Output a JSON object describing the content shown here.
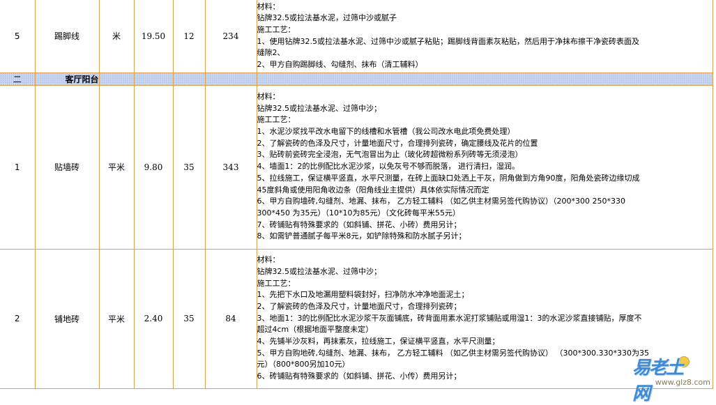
{
  "rows": [
    {
      "num": "5",
      "name": "踢脚线",
      "unit": "米",
      "price": "19.50",
      "qty": "12",
      "total": "234",
      "desc": [
        "材料：",
        "钻牌32.5或拉法基水泥，过筛中沙或腻子",
        "施工工艺：",
        "1、使用钻牌32.5或拉法基水泥、过筛中沙或腻子粘贴；踢脚线背面素灰粘贴，然后用于净抹布擦干净瓷砖表面及",
        "缝隙2、",
        "2、甲方自购踢脚线、勾缝剂、抹布（清工辅料）"
      ]
    },
    {
      "num": "1",
      "name": "贴墙砖",
      "unit": "平米",
      "price": "9.80",
      "qty": "35",
      "total": "343",
      "desc": [
        "材料：",
        "钻牌32.5或拉法基水泥、过筛中沙；",
        "施工工艺：",
        "1、水泥沙浆找平改水电留下的线槽和水管槽（我公司改水电此项免费处理）",
        "2、了解瓷砖的色泽及尺寸，计量地面尺寸，合理排列瓷砖，确定腰线及花片的位置",
        "3、贴砖前瓷砖完全浸泡，无气泡冒出为止（玻化砖超微粉系列砖等无须浸泡）",
        "4、墙面1：2的比例配比水泥沙浆，以免灰号不够而脱落，  进行清扫，湿润。",
        "5、拉线施工，保证横平竖直，水平尺测量，在砖上面缺口处洒上干灰，阴角做到方角90度，阳角处瓷砖边缘切成",
        "45度斜角或使用阳角收边条（阳角线业主提供）具体依实际情况而定",
        "6、甲方自购墙砖,勾缝剂、地漏、抹布，   乙方轻工辅料  （如乙供主材需另签代购协议）（200*300 250*330",
        "300*450 为35元）（10*10为85元）（文化砖每平米55元）",
        "7、砖铺贴有特殊要求的（如斜铺、拼花、小砖）费用另计；",
        "8、如需铲普通腻子每平米8元，如铲除特殊和防水腻子另计；"
      ]
    },
    {
      "num": "2",
      "name": "铺地砖",
      "unit": "平米",
      "price": "2.40",
      "qty": "35",
      "total": "84",
      "desc": [
        "材料：",
        "钻牌32.5或拉法基水泥、过筛中沙；",
        "施工工艺：",
        "1、先把下水口及地漏用塑料袋封好，扫净防水冲净地面泥土；",
        "2、了解瓷砖的色泽及尺寸，计量地面尺寸，合理排列瓷砖；",
        "3、地面1：3的比例配比水泥沙浆干灰面铺底，砖背面用素水泥打浆铺贴或用湿1：3的水泥沙浆直接铺贴，厚度不",
        "超过4cm（根据地面平整度未定）",
        "4、先铺半沙灰料，再抹素灰，拉线施工，保证横平竖直，水平尺测量；",
        "5、甲方自购地砖,勾缝剂、地漏、抹布，  乙方轻工辅料  （如乙供主材需另签代购协议）  （300*300.330*330为35",
        "元）（800*800另加10元）",
        "6、砖铺贴有特殊要求的（如斜铺、拼花、小传）费用另计；"
      ]
    }
  ],
  "section": {
    "num": "二",
    "title": "客厅阳台"
  },
  "watermark": {
    "text": "易老土网",
    "url": "www.glz8.com"
  }
}
